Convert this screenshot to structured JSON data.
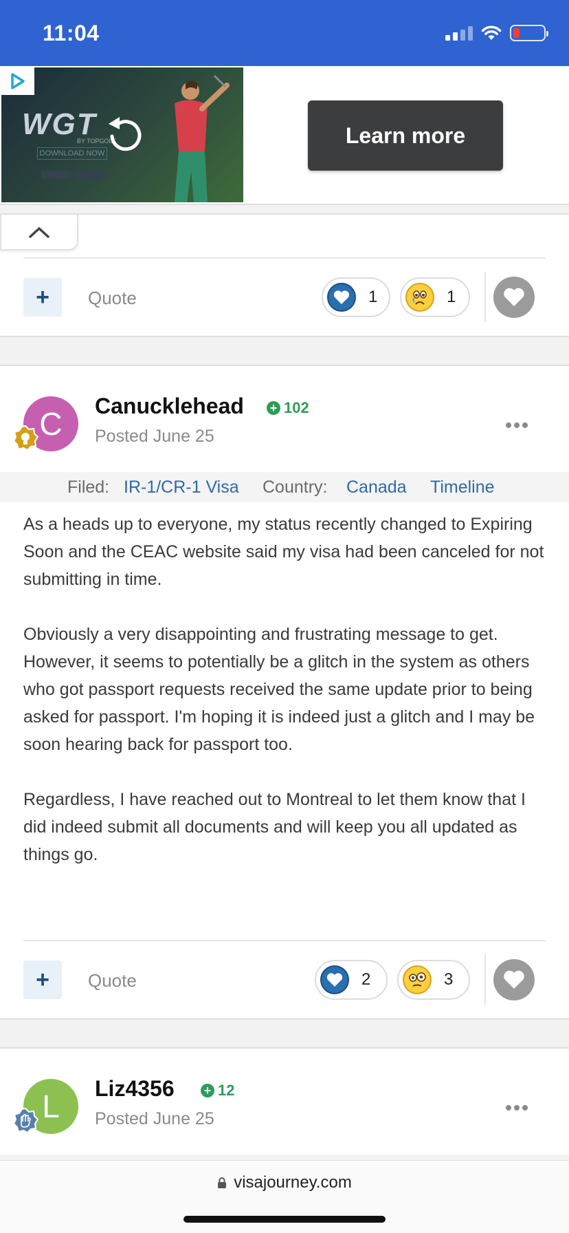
{
  "status_bar": {
    "time": "11:04",
    "icons": [
      "signal-icon",
      "wifi-icon",
      "battery-low-icon"
    ],
    "bg_color": "#2f63d1"
  },
  "ad": {
    "brand_text": "WGT",
    "brand_subtext": "BY TOPGOLF",
    "download_text": "DOWNLOAD NOW",
    "cta_label": "Learn more",
    "icons": [
      "adchoices-icon",
      "replay-icon"
    ]
  },
  "posts": [
    {
      "reactions": [
        {
          "type": "heart",
          "count": "1"
        },
        {
          "type": "sad",
          "count": "1"
        }
      ],
      "quote_label": "Quote",
      "plus_label": "+"
    },
    {
      "avatar_letter": "C",
      "avatar_color": "#c65fb0",
      "username": "Canucklehead",
      "reputation": "102",
      "posted": "Posted June 25",
      "filed": {
        "label": "Filed:",
        "visa": "IR-1/CR-1 Visa",
        "country_label": "Country:",
        "country": "Canada",
        "timeline": "Timeline"
      },
      "body": [
        "As a heads up to everyone, my status recently changed to Expiring Soon and the CEAC website said my visa had been canceled for not submitting in time.",
        "Obviously a very disappointing and frustrating message to get. However, it seems to potentially be a glitch in the system as others who got passport requests received the same update prior to being asked for passport. I'm hoping it is indeed just a glitch and I may be soon hearing back for passport too.",
        "Regardless, I have reached out to Montreal to let them know that I did indeed submit all documents and will keep you all updated as things go."
      ],
      "reactions": [
        {
          "type": "heart",
          "count": "2"
        },
        {
          "type": "confused",
          "count": "3"
        }
      ],
      "quote_label": "Quote",
      "plus_label": "+"
    },
    {
      "avatar_letter": "L",
      "avatar_color": "#8cc152",
      "username": "Liz4356",
      "reputation": "12",
      "posted": "Posted June 25"
    }
  ],
  "browser": {
    "url": "visajourney.com"
  }
}
